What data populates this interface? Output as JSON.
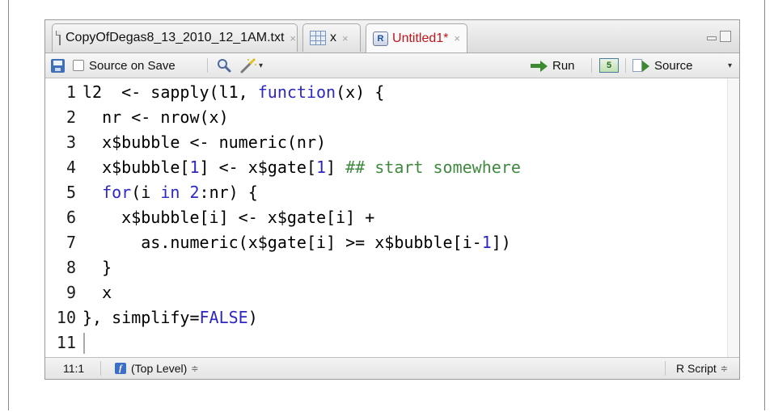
{
  "tabs": [
    {
      "label": "CopyOfDegas8_13_2010_12_1AM.txt",
      "close": "×",
      "icon": "document-icon",
      "active": false
    },
    {
      "label": "x",
      "close": "×",
      "icon": "data-grid-icon",
      "active": false
    },
    {
      "label": "Untitled1*",
      "close": "×",
      "icon": "r-script-icon",
      "active": true
    }
  ],
  "toolbar": {
    "source_on_save": "Source on Save",
    "run": "Run",
    "source": "Source",
    "dropdown_caret": "▾",
    "rerun_glyph": "5"
  },
  "code": {
    "line_numbers": [
      "1",
      "2",
      "3",
      "4",
      "5",
      "6",
      "7",
      "8",
      "9",
      "10",
      "11"
    ]
  },
  "status": {
    "position": "11:1",
    "scope": "(Top Level)",
    "scope_glyph": "f",
    "language": "R Script",
    "updown": "≑"
  },
  "colors": {
    "keyword": "#2d27c8",
    "comment": "#3f8a3f",
    "active_tab_text": "#c0141a"
  }
}
